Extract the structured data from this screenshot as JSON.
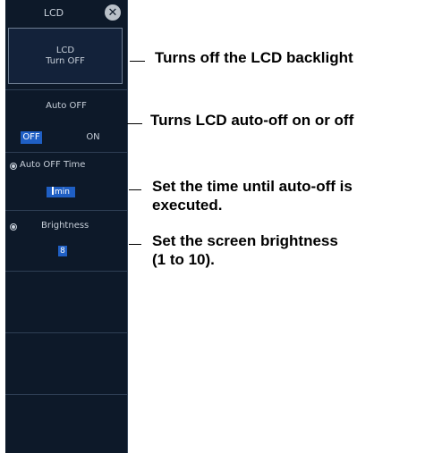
{
  "panel": {
    "title": "LCD",
    "close_icon": "close-icon",
    "turn_off_button": {
      "line1": "LCD",
      "line2": "Turn OFF"
    },
    "auto_off": {
      "label": "Auto OFF",
      "options": [
        "OFF",
        "ON"
      ],
      "selected": "OFF"
    },
    "auto_off_time": {
      "label": "Auto OFF Time",
      "value": "min"
    },
    "brightness": {
      "label": "Brightness",
      "value": "8"
    }
  },
  "annotations": [
    {
      "text": "Turns off the LCD backlight"
    },
    {
      "text": "Turns LCD auto-off on or off"
    },
    {
      "text": "Set the time until auto-off is",
      "text2": "executed."
    },
    {
      "text": "Set the screen brightness",
      "text2": "(1 to 10)."
    }
  ],
  "colors": {
    "panel_bg": "#0d1929",
    "accent": "#1f5fc4",
    "panel_text": "#c8d0da"
  }
}
